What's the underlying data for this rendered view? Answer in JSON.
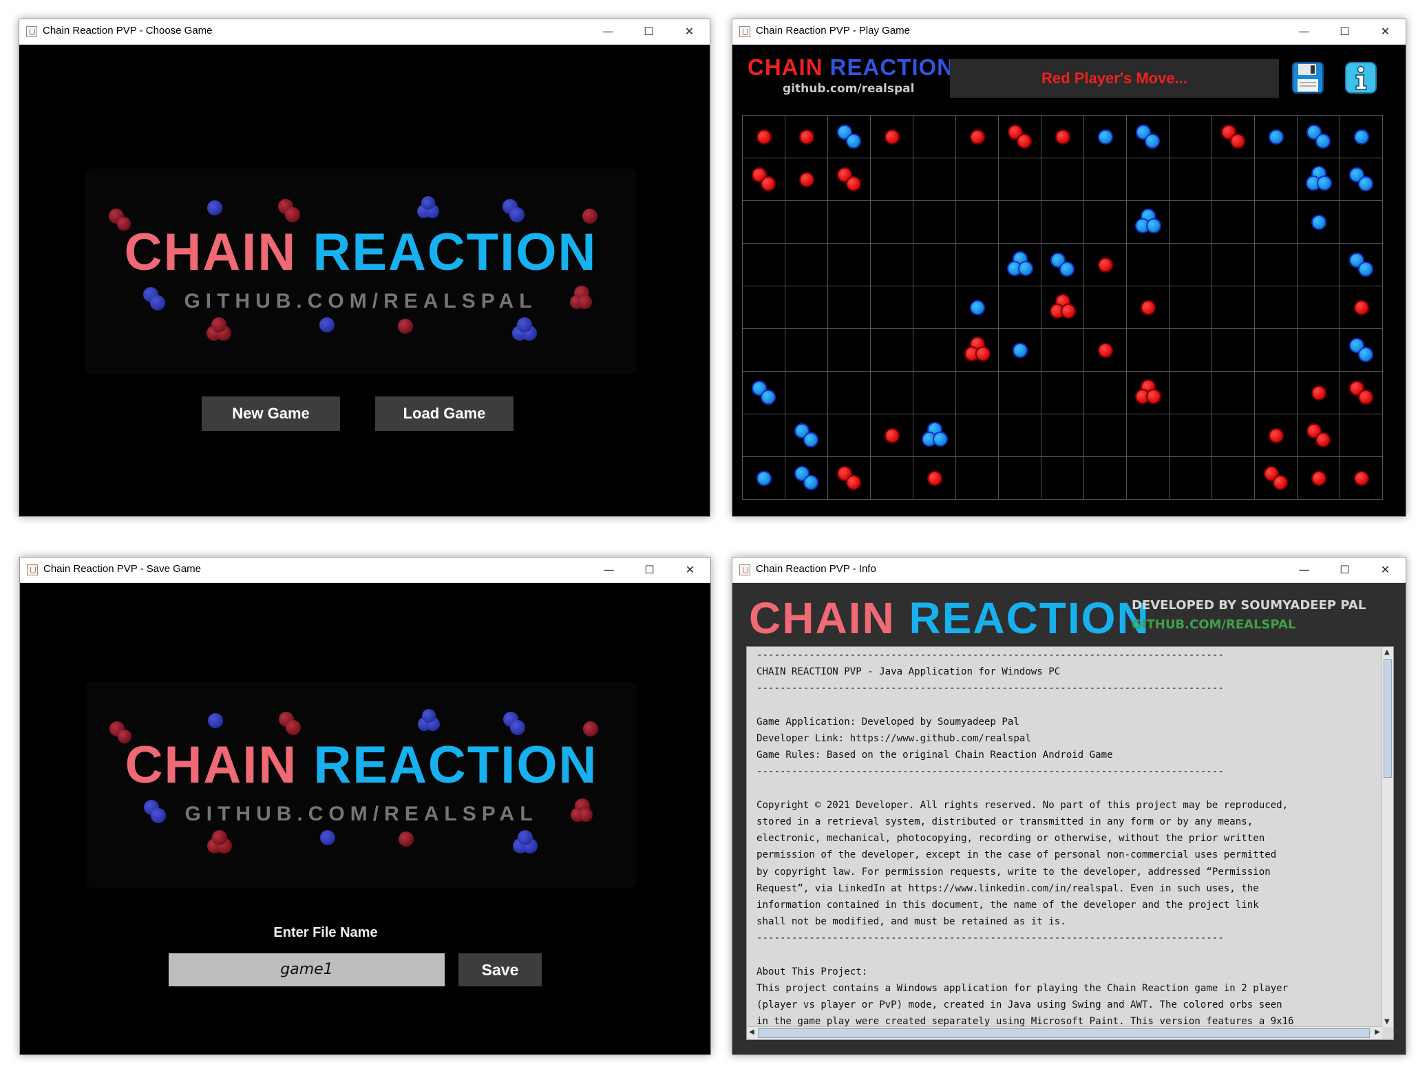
{
  "windows": {
    "choose": {
      "title": "Chain Reaction PVP - Choose Game",
      "new_game": "New Game",
      "load_game": "Load Game"
    },
    "play": {
      "title": "Chain Reaction PVP - Play Game",
      "status": "Red Player's Move...",
      "save_icon": "floppy-disk-icon",
      "info_icon": "info-icon",
      "grid": {
        "rows": 9,
        "cols": 15,
        "cells": [
          [
            "r1",
            "r1",
            "b2",
            "r1",
            "",
            "r1",
            "r2",
            "r1",
            "b1",
            "b2",
            "",
            "r2",
            "b1",
            "b2",
            "b1"
          ],
          [
            "r2",
            "r1",
            "r2",
            "",
            "",
            "",
            "",
            "",
            "",
            "",
            "",
            "",
            "",
            "b3",
            "b2"
          ],
          [
            "",
            "",
            "",
            "",
            "",
            "",
            "",
            "",
            "",
            "b3",
            "",
            "",
            "",
            "b1",
            ""
          ],
          [
            "",
            "",
            "",
            "",
            "",
            "",
            "b3",
            "b2",
            "r1",
            "",
            "",
            "",
            "",
            "",
            "b2"
          ],
          [
            "",
            "",
            "",
            "",
            "",
            "b1",
            "",
            "r3",
            "",
            "r1",
            "",
            "",
            "",
            "",
            "r1"
          ],
          [
            "",
            "",
            "",
            "",
            "",
            "r3",
            "b1",
            "",
            "r1",
            "",
            "",
            "",
            "",
            "",
            "b2"
          ],
          [
            "b2",
            "",
            "",
            "",
            "",
            "",
            "",
            "",
            "",
            "r3",
            "",
            "",
            "",
            "r1",
            "r2"
          ],
          [
            "",
            "b2",
            "",
            "r1",
            "b3",
            "",
            "",
            "",
            "",
            "",
            "",
            "",
            "r1",
            "r2",
            ""
          ],
          [
            "b1",
            "b2",
            "r2",
            "",
            "r1",
            "",
            "",
            "",
            "",
            "",
            "",
            "",
            "r2",
            "r1",
            "r1"
          ]
        ]
      }
    },
    "save": {
      "title": "Chain Reaction PVP - Save Game",
      "prompt": "Enter File Name",
      "file_name": "game1",
      "save": "Save"
    },
    "info": {
      "title": "Chain Reaction PVP - Info",
      "developed_by": "DEVELOPED BY SOUMYADEEP PAL",
      "github": "GITHUB.COM/REALSPAL",
      "text": "--------------------------------------------------------------------------------\nCHAIN REACTION PVP - Java Application for Windows PC\n--------------------------------------------------------------------------------\n\nGame Application: Developed by Soumyadeep Pal\nDeveloper Link: https://www.github.com/realspal\nGame Rules: Based on the original Chain Reaction Android Game\n--------------------------------------------------------------------------------\n\nCopyright © 2021 Developer. All rights reserved. No part of this project may be reproduced,\nstored in a retrieval system, distributed or transmitted in any form or by any means,\nelectronic, mechanical, photocopying, recording or otherwise, without the prior written\npermission of the developer, except in the case of personal non-commercial uses permitted\nby copyright law. For permission requests, write to the developer, addressed “Permission\nRequest”, via LinkedIn at https://www.linkedin.com/in/realspal. Even in such uses, the\ninformation contained in this document, the name of the developer and the project link\nshall not be modified, and must be retained as it is.\n--------------------------------------------------------------------------------\n\nAbout This Project:\nThis project contains a Windows application for playing the Chain Reaction game in 2 player\n(player vs player or PvP) mode, created in Java using Swing and AWT. The colored orbs seen\nin the game play were created separately using Microsoft Paint. This version features a 9x16"
    }
  },
  "branding": {
    "title_word1": "CHAIN",
    "title_word2": "REACTION",
    "subtitle": "GITHUB.COM/REALSPAL",
    "subtitle_small": "github.com/realspal"
  },
  "window_controls": {
    "minimize": "—",
    "maximize": "☐",
    "close": "✕"
  },
  "colors": {
    "red_title": "#ef6a74",
    "blue_title": "#17b1f0",
    "red_orb": "#e01010",
    "blue_orb": "#1a8fe0",
    "status_red": "#ef2020"
  }
}
